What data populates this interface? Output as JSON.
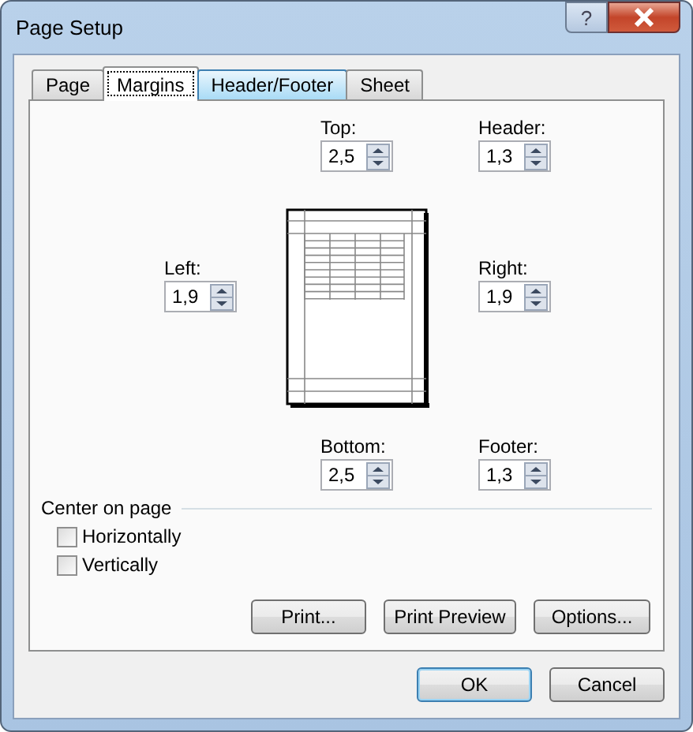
{
  "window": {
    "title": "Page Setup",
    "help": "?"
  },
  "tabs": [
    {
      "label": "Page",
      "selected": false,
      "hovered": false
    },
    {
      "label": "Margins",
      "selected": true,
      "hovered": false
    },
    {
      "label": "Header/Footer",
      "selected": false,
      "hovered": true
    },
    {
      "label": "Sheet",
      "selected": false,
      "hovered": false
    }
  ],
  "margins": {
    "top": {
      "label": "Top:",
      "value": "2,5"
    },
    "header": {
      "label": "Header:",
      "value": "1,3"
    },
    "left": {
      "label": "Left:",
      "value": "1,9"
    },
    "right": {
      "label": "Right:",
      "value": "1,9"
    },
    "bottom": {
      "label": "Bottom:",
      "value": "2,5"
    },
    "footer": {
      "label": "Footer:",
      "value": "1,3"
    }
  },
  "center_on_page": {
    "label": "Center on page",
    "options": [
      {
        "label": "Horizontally",
        "checked": false
      },
      {
        "label": "Vertically",
        "checked": false
      }
    ]
  },
  "action_buttons": [
    "Print...",
    "Print Preview",
    "Options..."
  ],
  "dialog_buttons": [
    {
      "label": "OK",
      "default": true
    },
    {
      "label": "Cancel",
      "default": false
    }
  ]
}
